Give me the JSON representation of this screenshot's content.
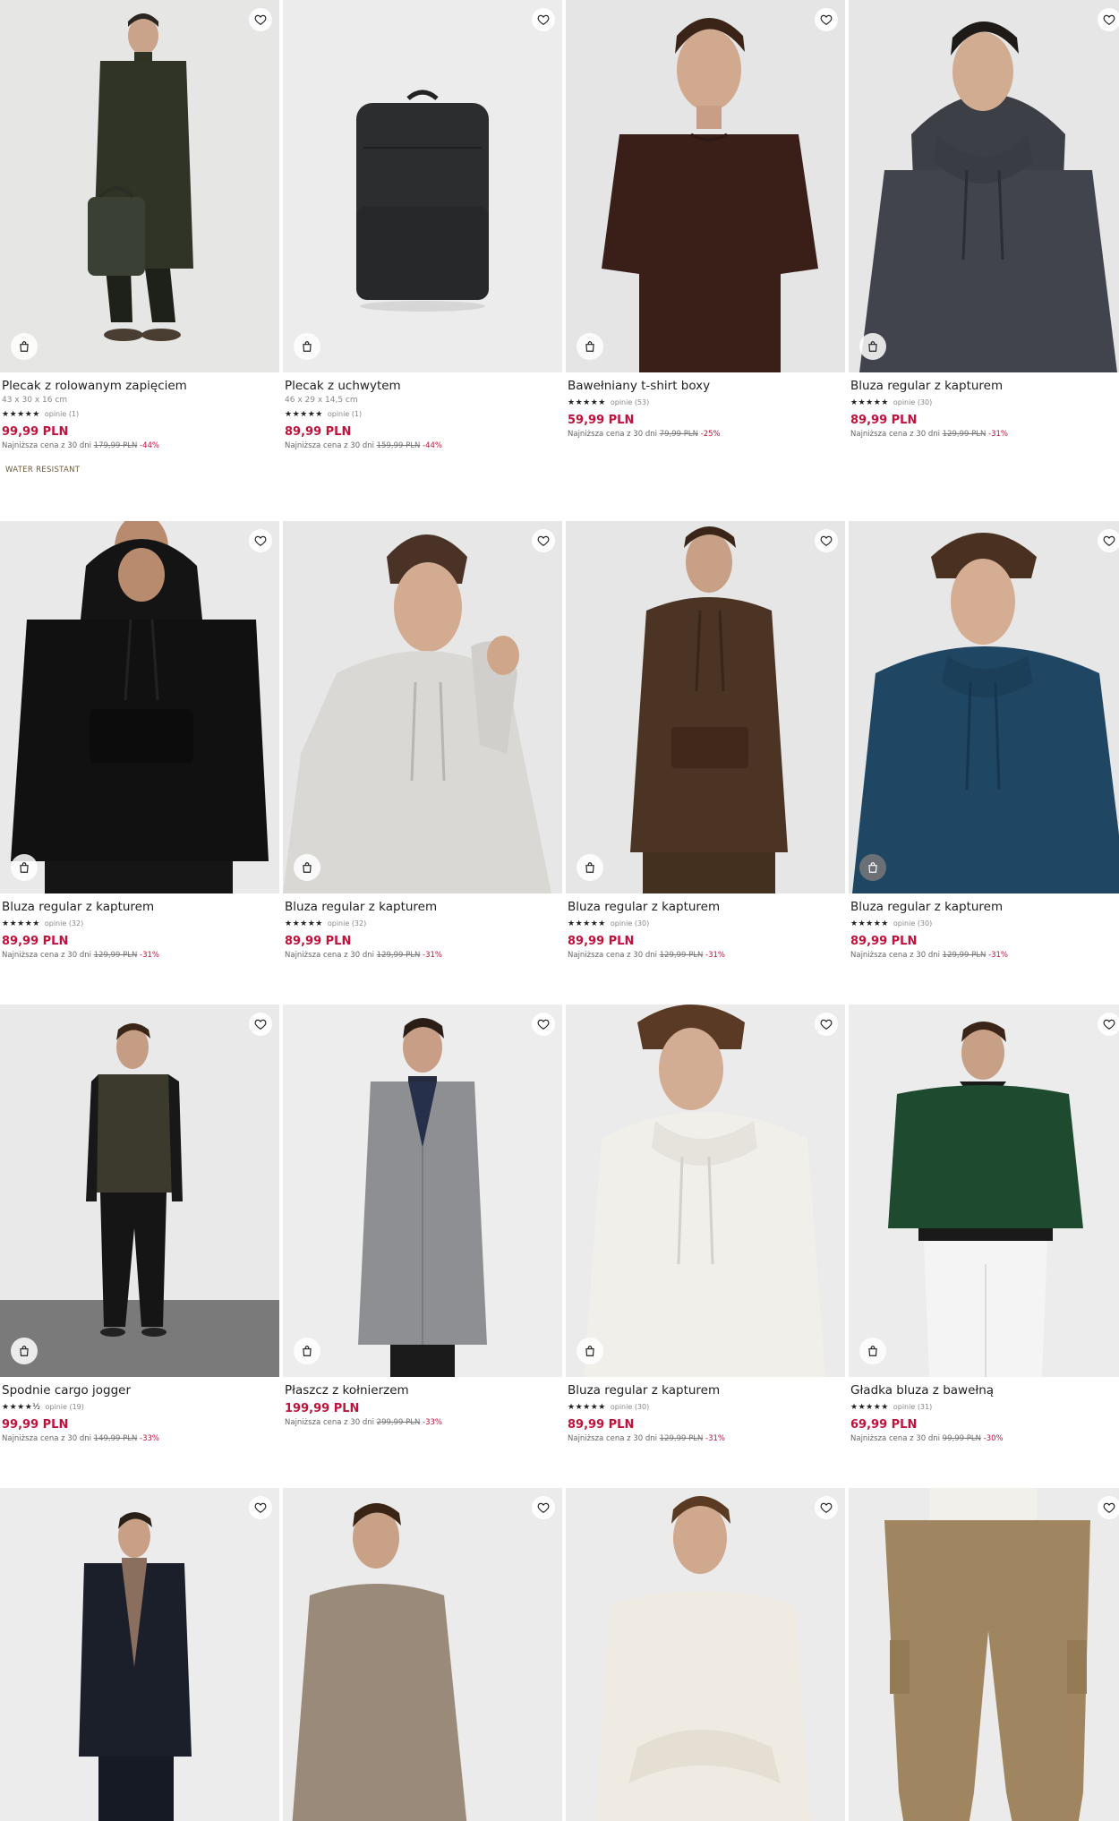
{
  "labels": {
    "lowest_prefix": "Najniższa cena z 30 dni",
    "reviews_prefix": "opinie"
  },
  "colors": {
    "price": "#c0123a",
    "text": "#222222",
    "badge": "#6b5a3e"
  },
  "icons": {
    "favorite": "heart-outline-icon",
    "quick_add": "shopping-bag-icon"
  },
  "products": [
    {
      "name": "Plecak z rolowanym zapięciem",
      "dims": "43 x 30 x 16 cm",
      "stars": "★★★★★",
      "reviews": "(1)",
      "price": "99,99 PLN",
      "old_price": "179,99 PLN",
      "discount": "-44%",
      "badge": "WATER RESISTANT",
      "scene": "model-coat-backpack"
    },
    {
      "name": "Plecak z uchwytem",
      "dims": "46 x 29 x 14,5 cm",
      "stars": "★★★★★",
      "reviews": "(1)",
      "price": "89,99 PLN",
      "old_price": "159,99 PLN",
      "discount": "-44%",
      "scene": "backpack"
    },
    {
      "name": "Bawełniany t-shirt boxy",
      "stars": "★★★★★",
      "reviews": "(53)",
      "price": "59,99 PLN",
      "old_price": "79,99 PLN",
      "discount": "-25%",
      "scene": "tshirt-brown"
    },
    {
      "name": "Bluza regular z kapturem",
      "stars": "★★★★★",
      "reviews": "(30)",
      "price": "89,99 PLN",
      "old_price": "129,99 PLN",
      "discount": "-31%",
      "scene": "hoodie-graphite"
    },
    {
      "name": "Bluza regular z kapturem",
      "stars": "★★★★★",
      "reviews": "(32)",
      "price": "89,99 PLN",
      "old_price": "129,99 PLN",
      "discount": "-31%",
      "scene": "hoodie-black"
    },
    {
      "name": "Bluza regular z kapturem",
      "stars": "★★★★★",
      "reviews": "(32)",
      "price": "89,99 PLN",
      "old_price": "129,99 PLN",
      "discount": "-31%",
      "scene": "hoodie-light-grey"
    },
    {
      "name": "Bluza regular z kapturem",
      "stars": "★★★★★",
      "reviews": "(30)",
      "price": "89,99 PLN",
      "old_price": "129,99 PLN",
      "discount": "-31%",
      "scene": "hoodie-brown"
    },
    {
      "name": "Bluza regular z kapturem",
      "stars": "★★★★★",
      "reviews": "(30)",
      "price": "89,99 PLN",
      "old_price": "129,99 PLN",
      "discount": "-31%",
      "scene": "hoodie-navy"
    },
    {
      "name": "Spodnie cargo jogger",
      "stars": "★★★★½",
      "reviews": "(19)",
      "price": "99,99 PLN",
      "old_price": "149,99 PLN",
      "discount": "-33%",
      "scene": "model-jogger"
    },
    {
      "name": "Płaszcz z kołnierzem",
      "price": "199,99 PLN",
      "old_price": "299,99 PLN",
      "discount": "-33%",
      "scene": "coat-grey"
    },
    {
      "name": "Bluza regular z kapturem",
      "stars": "★★★★★",
      "reviews": "(30)",
      "price": "89,99 PLN",
      "old_price": "129,99 PLN",
      "discount": "-31%",
      "scene": "hoodie-cream"
    },
    {
      "name": "Gładka bluza z bawełną",
      "stars": "★★★★★",
      "reviews": "(31)",
      "price": "69,99 PLN",
      "old_price": "99,99 PLN",
      "discount": "-30%",
      "scene": "sweatshirt-green"
    },
    {
      "name": "",
      "scene": "coat-black-model"
    },
    {
      "name": "",
      "scene": "sweater-beige"
    },
    {
      "name": "",
      "scene": "sweatshirt-cream"
    },
    {
      "name": "",
      "scene": "cargo-khaki"
    }
  ]
}
